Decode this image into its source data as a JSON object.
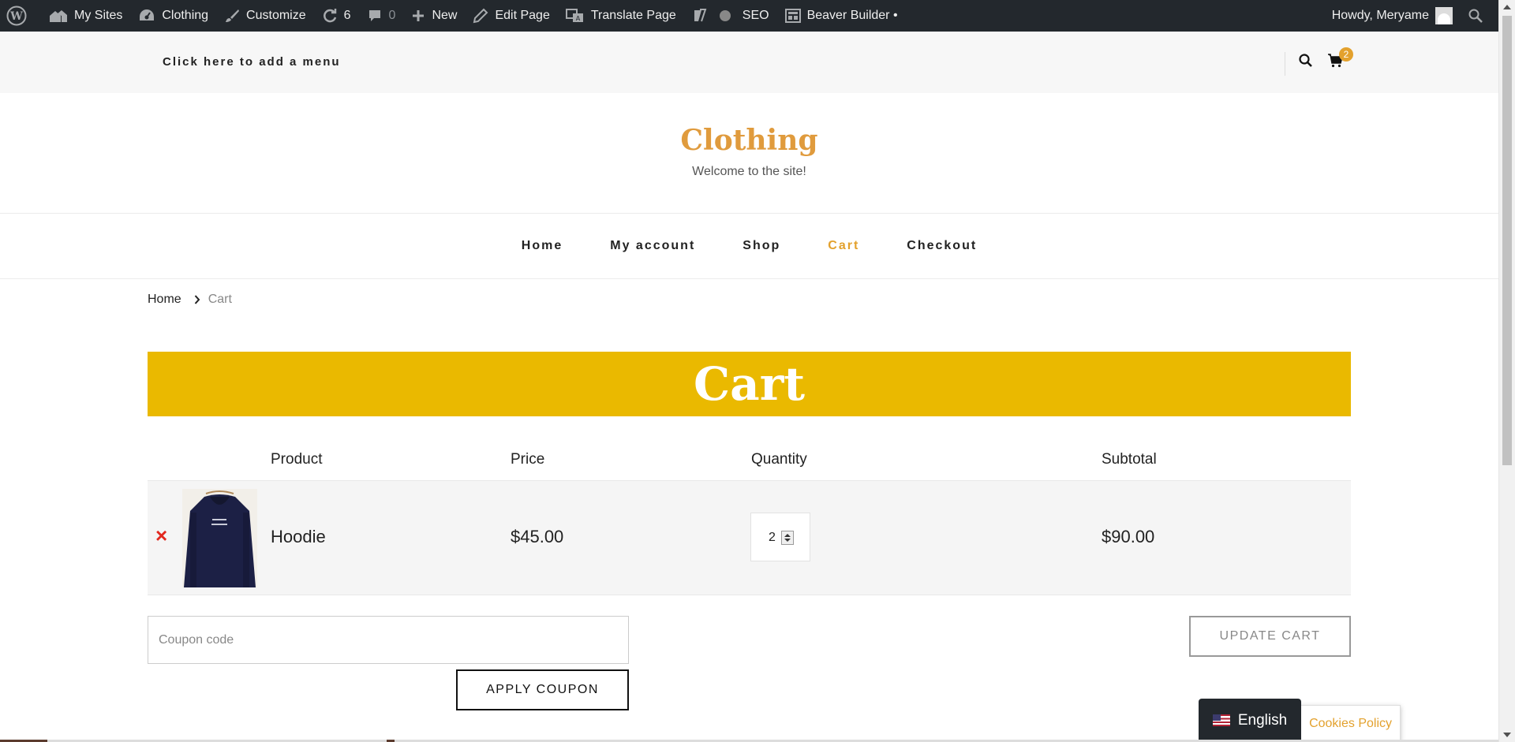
{
  "admin_bar": {
    "my_sites": "My Sites",
    "site_name": "Clothing",
    "customize": "Customize",
    "updates_count": "6",
    "comments_count": "0",
    "new": "New",
    "edit_page": "Edit Page",
    "translate_page": "Translate Page",
    "seo": "SEO",
    "beaver_builder": "Beaver Builder •",
    "howdy": "Howdy, Meryame"
  },
  "topbar": {
    "menu_link": "Click here to add a menu",
    "cart_count": "2"
  },
  "header": {
    "title": "Clothing",
    "tagline": "Welcome to the site!"
  },
  "nav": {
    "items": [
      {
        "label": "Home"
      },
      {
        "label": "My account"
      },
      {
        "label": "Shop"
      },
      {
        "label": "Cart"
      },
      {
        "label": "Checkout"
      }
    ],
    "current": "Cart"
  },
  "breadcrumb": {
    "home": "Home",
    "current": "Cart"
  },
  "page": {
    "title": "Cart"
  },
  "cart_table": {
    "headers": {
      "product": "Product",
      "price": "Price",
      "quantity": "Quantity",
      "subtotal": "Subtotal"
    },
    "rows": [
      {
        "remove": "×",
        "product": "Hoodie",
        "price": "$45.00",
        "quantity": "2",
        "subtotal": "$90.00"
      }
    ]
  },
  "coupon": {
    "placeholder": "Coupon code",
    "apply_label": "APPLY COUPON"
  },
  "update_cart_label": "UPDATE CART",
  "language": {
    "label": "English"
  },
  "cookies": {
    "label": "Cookies Policy"
  },
  "colors": {
    "accent": "#e3a12d",
    "banner": "#eab900",
    "admin_bar": "#23282d",
    "remove": "#e2281e"
  }
}
